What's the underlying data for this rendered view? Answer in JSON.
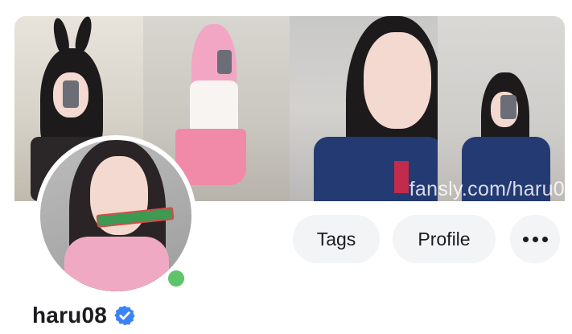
{
  "banner": {
    "watermark": "fansly.com/haru0"
  },
  "profile": {
    "username": "haru08",
    "verified_icon": "verified-badge-icon",
    "online_icon": "online-status-dot"
  },
  "actions": {
    "tags_label": "Tags",
    "profile_label": "Profile",
    "more_icon": "more-dots-icon"
  },
  "colors": {
    "online": "#5ec46a",
    "verified": "#3b82f6",
    "button_bg": "#f3f4f6"
  }
}
